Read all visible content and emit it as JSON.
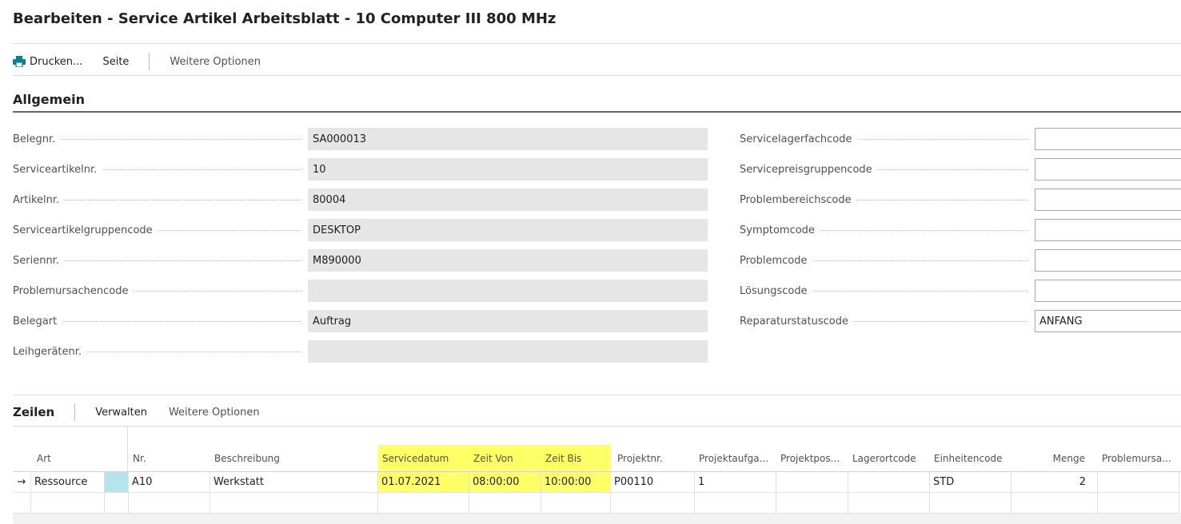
{
  "header": {
    "title": "Bearbeiten - Service Artikel Arbeitsblatt - 10 Computer III 800 MHz"
  },
  "toolbar": {
    "print_label": "Drucken...",
    "page_label": "Seite",
    "more_label": "Weitere Optionen",
    "print_icon": "printer-icon"
  },
  "section": {
    "title": "Allgemein"
  },
  "left_fields": [
    {
      "label": "Belegnr.",
      "value": "SA000013"
    },
    {
      "label": "Serviceartikelnr.",
      "value": "10"
    },
    {
      "label": "Artikelnr.",
      "value": "80004"
    },
    {
      "label": "Serviceartikelgruppencode",
      "value": "DESKTOP"
    },
    {
      "label": "Seriennr.",
      "value": "M890000"
    },
    {
      "label": "Problemursachencode",
      "value": ""
    },
    {
      "label": "Belegart",
      "value": "Auftrag"
    },
    {
      "label": "Leihgerätenr.",
      "value": ""
    }
  ],
  "right_fields": [
    {
      "label": "Servicelagerfachcode",
      "value": ""
    },
    {
      "label": "Servicepreisgruppencode",
      "value": ""
    },
    {
      "label": "Problembereichscode",
      "value": ""
    },
    {
      "label": "Symptomcode",
      "value": ""
    },
    {
      "label": "Problemcode",
      "value": ""
    },
    {
      "label": "Lösungscode",
      "value": ""
    },
    {
      "label": "Reparaturstatuscode",
      "value": "ANFANG"
    }
  ],
  "lines": {
    "title": "Zeilen",
    "manage_label": "Verwalten",
    "more_label": "Weitere Optionen",
    "columns": [
      "Art",
      "Nr.",
      "Beschreibung",
      "Servicedatum",
      "Zeit Von",
      "Zeit Bis",
      "Projektnr.",
      "Projektaufga...",
      "Projektpos...",
      "Lagerortcode",
      "Einheitencode",
      "Menge",
      "Problemursa..."
    ],
    "rows": [
      {
        "marker": "→",
        "art": "Ressource",
        "nr": "A10",
        "beschreibung": "Werkstatt",
        "servicedatum": "01.07.2021",
        "zeit_von": "08:00:00",
        "zeit_bis": "10:00:00",
        "projektnr": "P00110",
        "projektaufgabe": "1",
        "projektpos": "",
        "lagerortcode": "",
        "einheitencode": "STD",
        "menge": "2",
        "problemursache": ""
      }
    ],
    "highlight_color": "#ffff66",
    "selected_cell_color": "#b3e5ec"
  },
  "colors": {
    "accent": "#00838f",
    "readonly_bg": "#e6e6e6"
  }
}
